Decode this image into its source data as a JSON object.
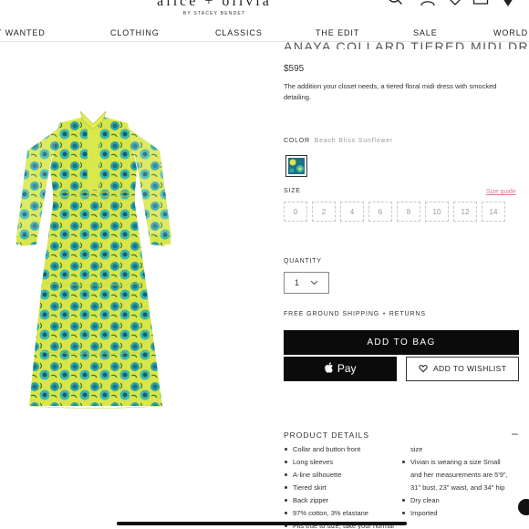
{
  "header": {
    "brand_name": "alice + olivia",
    "brand_sub": "BY STACEY BENDET"
  },
  "nav": {
    "items": [
      "T WANTED",
      "CLOTHING",
      "CLASSICS",
      "THE EDIT",
      "SALE",
      "WORLD"
    ]
  },
  "product": {
    "title": "ANAYA COLLARD TIERED MIDI DRESS",
    "price": "$595",
    "description": "The addition your closet needs, a tiered floral midi dress with smocked detailing.",
    "image_alt": "floral-dress-image"
  },
  "color": {
    "label": "COLOR",
    "value": "Beach Bliss Sunflower"
  },
  "size": {
    "label": "SIZE",
    "guide_label": "Size guide",
    "options": [
      "0",
      "2",
      "4",
      "6",
      "8",
      "10",
      "12",
      "14"
    ]
  },
  "quantity": {
    "label": "QUANTITY",
    "value": "1"
  },
  "shipping_text": "FREE GROUND SHIPPING + RETURNS",
  "actions": {
    "add_to_bag": "ADD TO BAG",
    "apple_pay": "Pay",
    "wishlist": "ADD TO WISHLIST"
  },
  "details": {
    "heading": "PRODUCT DETAILS",
    "toggle": "–",
    "left": [
      {
        "text": "Collar and button front",
        "bullet": true
      },
      {
        "text": "Long sleeves",
        "bullet": true
      },
      {
        "text": "A-line silhouette",
        "bullet": true
      },
      {
        "text": "Tiered skirt",
        "bullet": true
      },
      {
        "text": "Back zipper",
        "bullet": true
      },
      {
        "text": "97% cotton, 3% elastane",
        "bullet": true
      },
      {
        "text": "Fits true to size, take your normal",
        "bullet": true
      }
    ],
    "right": [
      {
        "text": "size",
        "bullet": false
      },
      {
        "text": "Vivian is wearing a size Small",
        "bullet": true
      },
      {
        "text": "and her measurements are 5'9\",",
        "bullet": false
      },
      {
        "text": "31\" bust, 23\" waist, and 34\" hip",
        "bullet": false
      },
      {
        "text": "Dry clean",
        "bullet": true
      },
      {
        "text": "Imported",
        "bullet": true
      }
    ]
  },
  "colors": {
    "accent_black": "#0b0b0b",
    "size_guide_pink": "#d77a8e",
    "dress_yellow": "#d9e84a",
    "dress_teal": "#2aa6a8"
  },
  "icons": [
    "search-icon",
    "account-icon",
    "wishlist-heart-icon",
    "mail-icon",
    "location-pin-icon",
    "heart-icon",
    "apple-logo-icon",
    "chevron-down-icon",
    "chat-icon"
  ]
}
